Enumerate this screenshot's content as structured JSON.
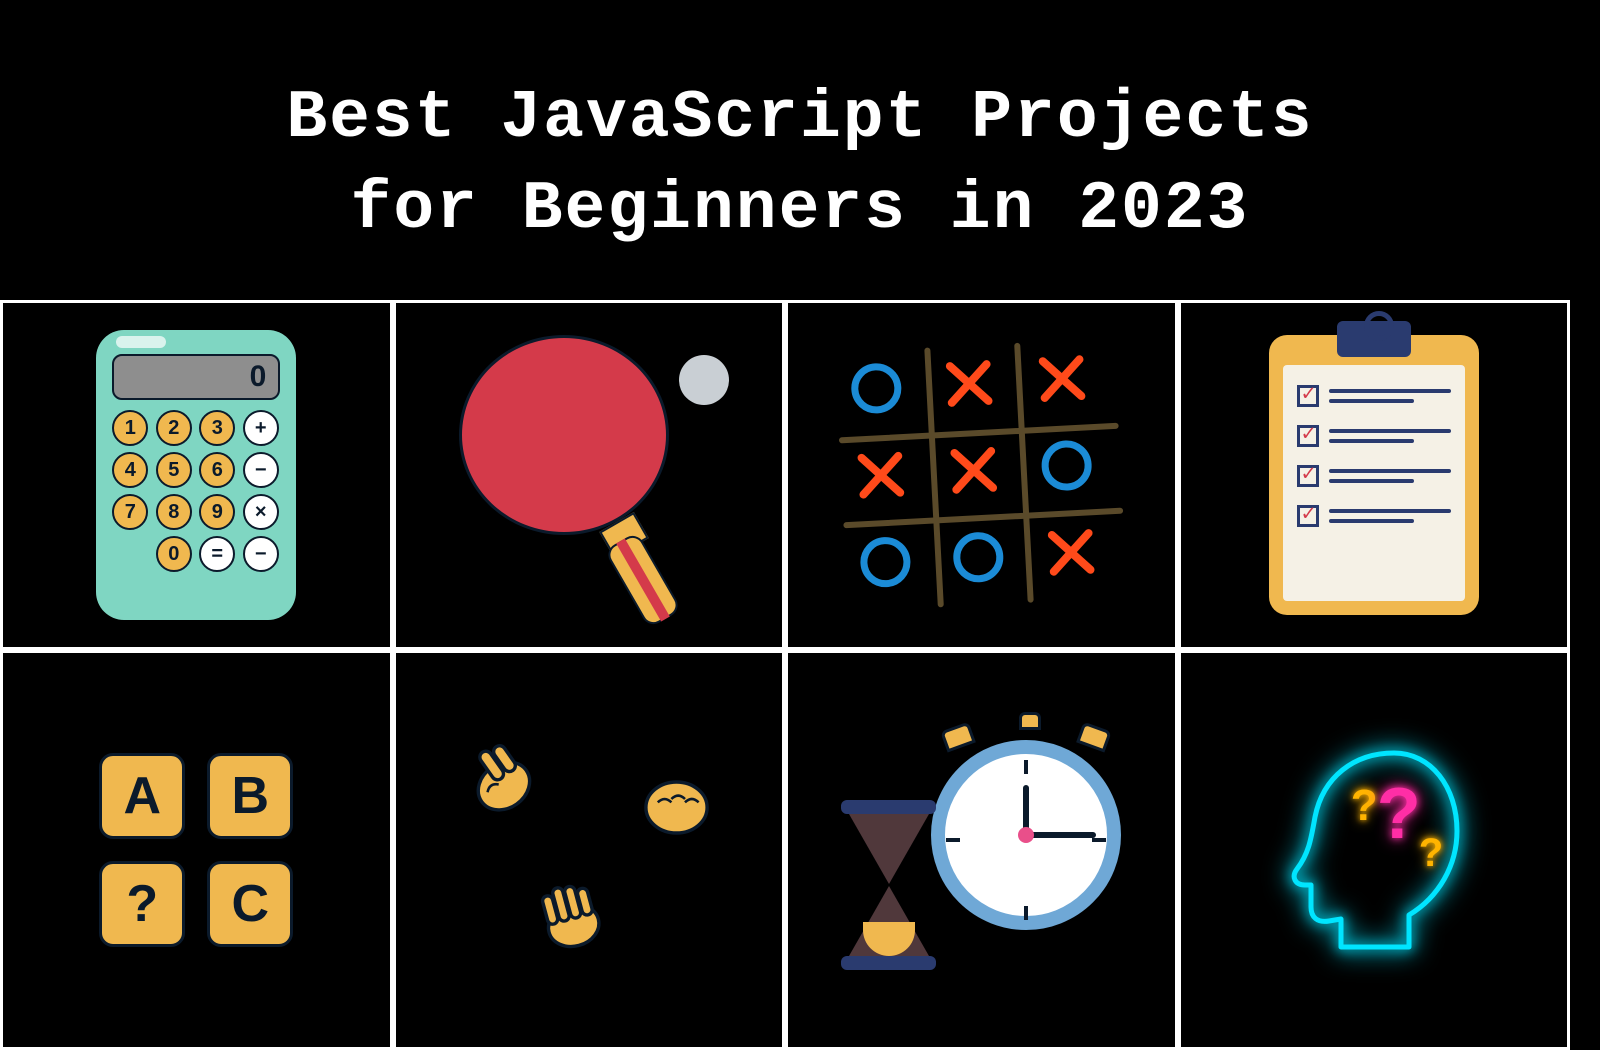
{
  "title": {
    "line1": "Best JavaScript Projects",
    "line2": "for Beginners in 2023"
  },
  "projects": [
    {
      "id": "calculator",
      "name": "Calculator",
      "icon": "calculator-icon"
    },
    {
      "id": "ping-pong",
      "name": "Ping Pong Game",
      "icon": "ping-pong-icon"
    },
    {
      "id": "tic-tac-toe",
      "name": "Tic Tac Toe",
      "icon": "tic-tac-toe-icon"
    },
    {
      "id": "todo-list",
      "name": "To-Do List",
      "icon": "clipboard-checklist-icon"
    },
    {
      "id": "hangman",
      "name": "Hangman / Word Game",
      "icon": "letter-blocks-icon"
    },
    {
      "id": "rock-paper-scissors",
      "name": "Rock Paper Scissors",
      "icon": "rock-paper-scissors-icon"
    },
    {
      "id": "countdown-timer",
      "name": "Countdown Timer",
      "icon": "clock-hourglass-icon"
    },
    {
      "id": "quiz-app",
      "name": "Quiz App",
      "icon": "neon-head-question-icon"
    }
  ],
  "calculator": {
    "display": "0",
    "keys": [
      {
        "t": "1",
        "k": "num"
      },
      {
        "t": "2",
        "k": "num"
      },
      {
        "t": "3",
        "k": "num"
      },
      {
        "t": "+",
        "k": "op"
      },
      {
        "t": "4",
        "k": "num"
      },
      {
        "t": "5",
        "k": "num"
      },
      {
        "t": "6",
        "k": "num"
      },
      {
        "t": "−",
        "k": "op"
      },
      {
        "t": "7",
        "k": "num"
      },
      {
        "t": "8",
        "k": "num"
      },
      {
        "t": "9",
        "k": "num"
      },
      {
        "t": "×",
        "k": "op"
      },
      {
        "t": "",
        "k": "num"
      },
      {
        "t": "0",
        "k": "num"
      },
      {
        "t": "=",
        "k": "op"
      },
      {
        "t": "−",
        "k": "op"
      }
    ]
  },
  "tictactoe": {
    "board": [
      [
        "O",
        "X",
        "X"
      ],
      [
        "X",
        "X",
        "O"
      ],
      [
        "O",
        "O",
        "X"
      ]
    ]
  },
  "letter_blocks": {
    "a": "A",
    "b": "B",
    "c": "?",
    "d": "C"
  },
  "quiz": {
    "q1": "?",
    "q2": "?",
    "q3": "?"
  }
}
